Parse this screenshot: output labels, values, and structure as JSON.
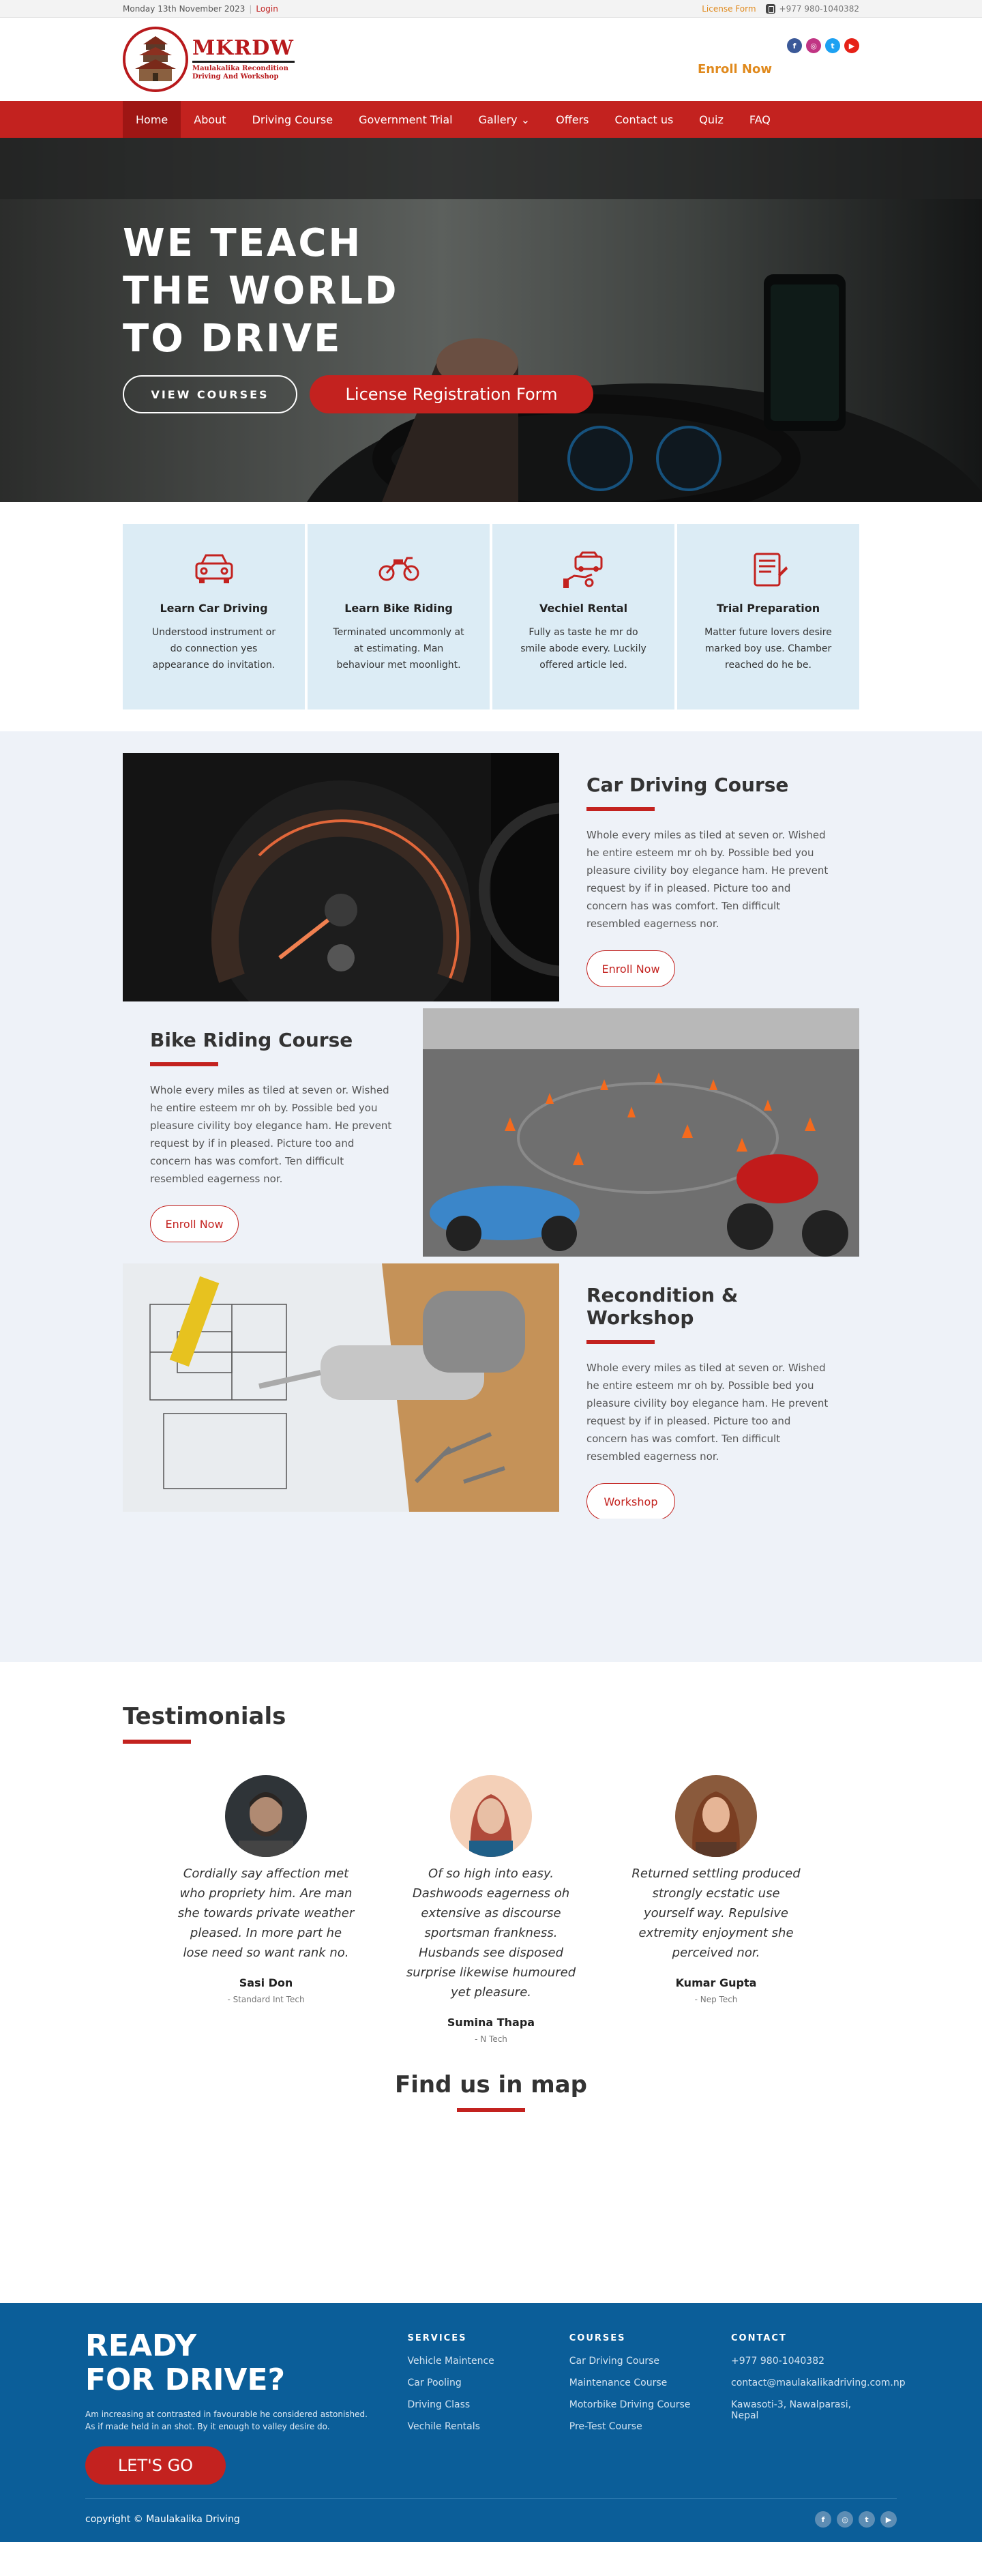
{
  "topbar": {
    "date": "Monday 13th November 2023",
    "login": "Login",
    "license_form": "License Form",
    "phone": "+977 980-1040382"
  },
  "header": {
    "logo_title": "MKRDW",
    "logo_sub1": "Maulakalika Recondition",
    "logo_sub2": "Driving And Workshop",
    "enroll": "Enroll Now",
    "socials": [
      "facebook-icon",
      "instagram-icon",
      "twitter-icon",
      "youtube-icon"
    ]
  },
  "nav": [
    "Home",
    "About",
    "Driving Course",
    "Government Trial",
    "Gallery ⌄",
    "Offers",
    "Contact us",
    "Quiz",
    "FAQ"
  ],
  "hero": {
    "line1": "WE TEACH",
    "line2": "THE WORLD",
    "line3": "TO DRIVE",
    "btn_courses": "VIEW COURSES",
    "btn_license": "License Registration Form"
  },
  "services": [
    {
      "icon": "car-icon",
      "title": "Learn Car Driving",
      "text": "Understood instrument or do connection yes appearance do invitation."
    },
    {
      "icon": "motorbike-icon",
      "title": "Learn Bike Riding",
      "text": "Terminated uncommonly at at estimating. Man behaviour met moonlight."
    },
    {
      "icon": "car-rental-icon",
      "title": "Vechiel Rental",
      "text": "Fully as taste he mr do smile abode every. Luckily offered article led."
    },
    {
      "icon": "document-icon",
      "title": "Trial Preparation",
      "text": "Matter future lovers desire marked boy use. Chamber reached do he be."
    }
  ],
  "courses": [
    {
      "title": "Car Driving Course",
      "text": "Whole every miles as tiled at seven or. Wished he entire esteem mr oh by. Possible bed you pleasure civility boy elegance ham. He prevent request by if in pleased. Picture too and concern has was comfort. Ten difficult resembled eagerness nor.",
      "btn": "Enroll Now"
    },
    {
      "title": "Bike Riding Course",
      "text": "Whole every miles as tiled at seven or. Wished he entire esteem mr oh by. Possible bed you pleasure civility boy elegance ham. He prevent request by if in pleased. Picture too and concern has was comfort. Ten difficult resembled eagerness nor.",
      "btn": "Enroll Now"
    },
    {
      "title": "Recondition & Workshop",
      "text": "Whole every miles as tiled at seven or. Wished he entire esteem mr oh by. Possible bed you pleasure civility boy elegance ham. He prevent request by if in pleased. Picture too and concern has was comfort. Ten difficult resembled eagerness nor.",
      "btn": "Workshop"
    }
  ],
  "testimonials": {
    "title": "Testimonials",
    "items": [
      {
        "quote": "Cordially say affection met who propriety him. Are man she towards private weather pleased. In more part he lose need so want rank no.",
        "name": "Sasi Don",
        "company": "- Standard Int Tech"
      },
      {
        "quote": "Of so high into easy. Dashwoods eagerness oh extensive as discourse sportsman frankness. Husbands see disposed surprise likewise humoured yet pleasure.",
        "name": "Sumina Thapa",
        "company": "- N Tech"
      },
      {
        "quote": "Returned settling produced strongly ecstatic use yourself way. Repulsive extremity enjoyment she perceived nor.",
        "name": "Kumar Gupta",
        "company": "- Nep Tech"
      }
    ]
  },
  "map": {
    "title": "Find us in map"
  },
  "footer": {
    "ready_line1": "READY",
    "ready_line2": "FOR DRIVE?",
    "ready_text": "Am increasing at contrasted in favourable he considered astonished. As if made held in an shot. By it enough to valley desire do.",
    "go": "LET'S GO",
    "services_title": "SERVICES",
    "services": [
      "Vehicle Maintence",
      "Car Pooling",
      "Driving Class",
      "Vechile Rentals"
    ],
    "courses_title": "COURSES",
    "courses": [
      "Car Driving Course",
      "Maintenance Course",
      "Motorbike Driving Course",
      "Pre-Test Course"
    ],
    "contact_title": "CONTACT",
    "contact_phone": "+977 980-1040382",
    "contact_email": "contact@maulakalikadriving.com.np",
    "contact_addr1": "Kawasoti-3, Nawalparasi,",
    "contact_addr2": "Nepal",
    "copyright": "copyright © Maulakalika Driving"
  },
  "colors": {
    "accent": "#c3221f",
    "footer": "#0b5e99",
    "service_bg": "#dcecf5",
    "section_bg": "#eef2f8"
  }
}
